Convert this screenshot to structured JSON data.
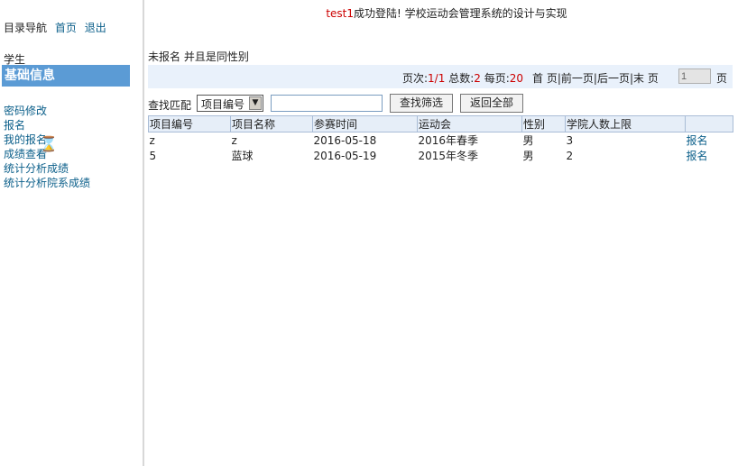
{
  "nav": {
    "label": "目录导航",
    "home": "首页",
    "logout": "退出"
  },
  "sidebar": {
    "role": "学生",
    "section_title": "基础信息",
    "items": [
      {
        "label": "密码修改"
      },
      {
        "label": "报名"
      },
      {
        "label": "我的报名"
      },
      {
        "label": "成绩查看"
      },
      {
        "label": "统计分析成绩"
      },
      {
        "label": "统计分析院系成绩"
      }
    ]
  },
  "header": {
    "user": "test1",
    "message": "成功登陆! 学校运动会管理系统的设计与实现"
  },
  "main": {
    "subtitle": "未报名 并且是同性别"
  },
  "pager": {
    "page_label": "页次:",
    "page_value": "1/1",
    "total_label": "总数:",
    "total_value": "2",
    "per_page_label": "每页:",
    "per_page_value": "20",
    "first": "首 页",
    "prev": "前一页",
    "next": "后一页",
    "last": "末 页",
    "sep": "|",
    "page_input_value": "1",
    "page_suffix": "页"
  },
  "search": {
    "label": "查找匹配",
    "selected": "项目编号",
    "input_value": "",
    "filter_button": "查找筛选",
    "reset_button": "返回全部"
  },
  "table": {
    "columns": [
      "项目编号",
      "项目名称",
      "参赛时间",
      "运动会",
      "性别",
      "学院人数上限",
      ""
    ],
    "rows": [
      {
        "id": "z",
        "name": "z",
        "date": "2016-05-18",
        "meet": "2016年春季",
        "gender": "男",
        "limit": "3",
        "action": "报名"
      },
      {
        "id": "5",
        "name": "蓝球",
        "date": "2016-05-19",
        "meet": "2015年冬季",
        "gender": "男",
        "limit": "2",
        "action": "报名"
      }
    ]
  },
  "colors": {
    "section_header": "#5b9bd5",
    "link": "#0b5f8a",
    "highlight_red": "#cc0000",
    "pager_bg": "#e9f1fb"
  },
  "icons": {
    "cursor": "hourglass-icon"
  }
}
